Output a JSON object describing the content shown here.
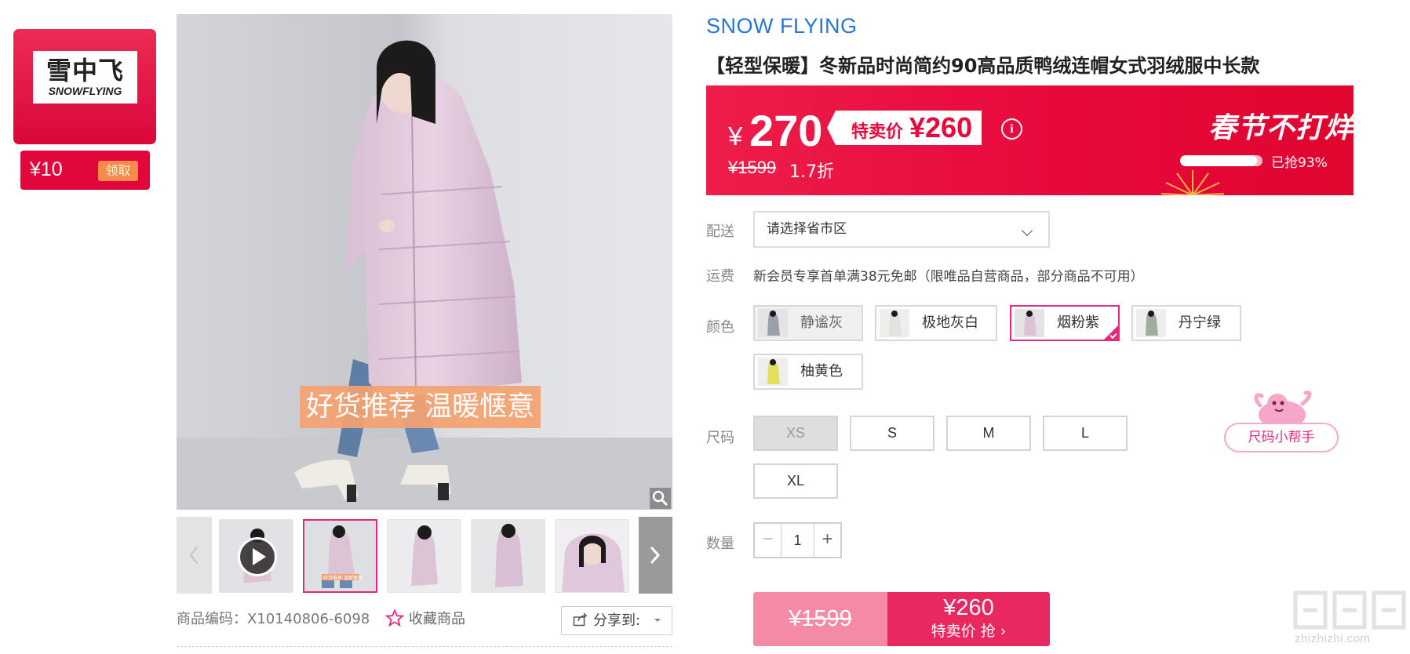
{
  "brand_badge": {
    "logo_cn": "雪中飞",
    "logo_en": "SNOWFLYING",
    "coupon_value": "¥10",
    "coupon_action": "领取"
  },
  "gallery": {
    "main_image_caption": "好货推荐 温暖惬意",
    "zoom_icon": "magnifier-icon",
    "thumbnail_count": 5,
    "active_thumbnail_index": 1,
    "thumbnail_1_caption": "好货推荐 温暖惬意",
    "prev_icon": "chevron-left-icon",
    "next_icon": "chevron-right-icon",
    "play_icon": "play-icon"
  },
  "footer": {
    "sku_text": "商品编码：X10140806-6098",
    "favorite_label": "收藏商品",
    "favorite_icon": "star-outline-icon",
    "share_label": "分享到:",
    "share_icon": "share-icon",
    "share_caret": "caret-down-icon"
  },
  "product": {
    "brand_name": "SNOW FLYING",
    "title": "【轻型保暖】冬新品时尚简约90高品质鸭绒连帽女式羽绒服中长款"
  },
  "price_banner": {
    "currency": "¥",
    "price": "270",
    "special_label": "特卖价",
    "special_price": "¥260",
    "info_icon": "info-icon",
    "original_price": "¥1599",
    "discount": "1.7折",
    "slogan": "春节不打烊",
    "sold_percent": 93,
    "sold_text": "已抢93%",
    "accent_color": "#e8083c"
  },
  "delivery": {
    "label": "配送",
    "placeholder": "请选择省市区",
    "chevron_icon": "chevron-down-icon"
  },
  "shipping": {
    "label": "运费",
    "text": "新会员专享首单满38元免邮（限唯品自营商品，部分商品不可用）"
  },
  "colors": {
    "label": "颜色",
    "options": [
      {
        "name": "静谧灰",
        "state": "disabled"
      },
      {
        "name": "极地灰白",
        "state": "normal"
      },
      {
        "name": "烟粉紫",
        "state": "selected"
      },
      {
        "name": "丹宁绿",
        "state": "normal"
      },
      {
        "name": "柚黄色",
        "state": "normal"
      }
    ],
    "selected_color": "#e6287f"
  },
  "sizes": {
    "label": "尺码",
    "options": [
      {
        "name": "XS",
        "state": "disabled"
      },
      {
        "name": "S",
        "state": "normal"
      },
      {
        "name": "M",
        "state": "normal"
      },
      {
        "name": "L",
        "state": "normal"
      },
      {
        "name": "XL",
        "state": "normal"
      }
    ],
    "helper_label": "尺码小帮手",
    "helper_icon": "mascot-icon"
  },
  "quantity": {
    "label": "数量",
    "minus": "−",
    "value": "1",
    "plus": "+"
  },
  "buy": {
    "original_price": "¥1599",
    "special_price": "¥260",
    "action_label": "特卖价 抢 ›"
  },
  "watermark": {
    "site": "zhizhizhi.com",
    "icon": "site-logo-icon"
  }
}
